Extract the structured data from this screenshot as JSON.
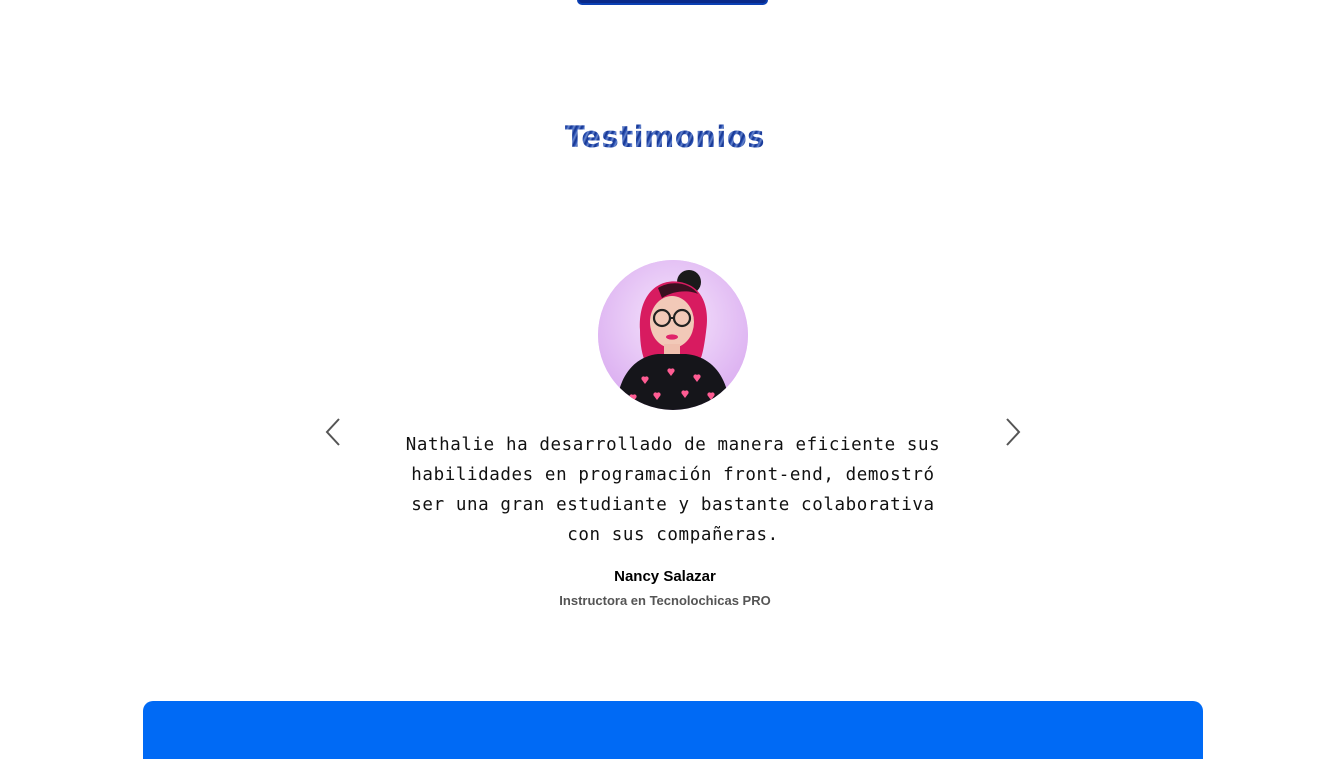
{
  "colors": {
    "top_button": "#0a2a8a",
    "title": "#1d3f9a",
    "panel": "#006af5",
    "quote_text": "#111111",
    "role_text": "#555555",
    "arrow": "#555555"
  },
  "testimonials": {
    "title": "Testimonios",
    "quote": "Nathalie ha desarrollado de manera eficiente sus habilidades en programación front-end, demostró ser una gran estudiante y bastante colaborativa con sus compañeras.",
    "author_name": "Nancy Salazar",
    "author_role": "Instructora en Tecnolochicas PRO",
    "prev_icon": "chevron-left-icon",
    "next_icon": "chevron-right-icon"
  }
}
